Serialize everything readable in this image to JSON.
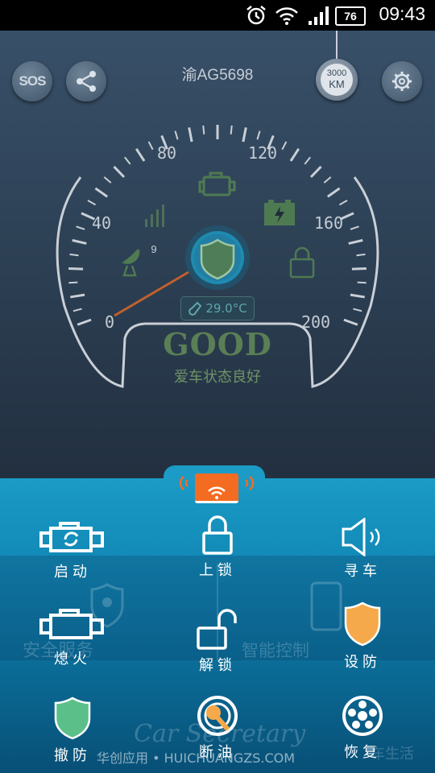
{
  "status_bar": {
    "time": "09:43",
    "battery": "76"
  },
  "header": {
    "plate": "渝AG5698",
    "sos_label": "SOS",
    "mileage_value": "3000",
    "mileage_unit": "KM"
  },
  "gauge": {
    "ticks": [
      "0",
      "40",
      "80",
      "120",
      "160",
      "200"
    ],
    "satellite_count": "9",
    "temperature": "29.0°C",
    "status_title": "GOOD",
    "status_subtitle": "爱车状态良好",
    "colors": {
      "good": "#5a7f55",
      "needle": "#c0602d",
      "shield": "#1e8bb0"
    }
  },
  "watermark": {
    "safety": "安全服务",
    "smart": "智能控制",
    "brand": "Car Secretary",
    "slogan": "车生活"
  },
  "controls": [
    {
      "label": "启动",
      "icon": "engine-start-icon"
    },
    {
      "label": "上锁",
      "icon": "lock-icon"
    },
    {
      "label": "寻车",
      "icon": "speaker-icon"
    },
    {
      "label": "熄火",
      "icon": "engine-stop-icon"
    },
    {
      "label": "解锁",
      "icon": "unlock-icon"
    },
    {
      "label": "设防",
      "icon": "shield-orange-icon"
    },
    {
      "label": "撤防",
      "icon": "shield-green-icon"
    },
    {
      "label": "断油",
      "icon": "oil-cut-icon"
    },
    {
      "label": "恢复",
      "icon": "wheel-icon"
    }
  ],
  "footer": {
    "text": "华创应用 • HUICHUANGZS.COM"
  },
  "accent_colors": {
    "panel": "#1b9bc6",
    "tab": "#f36c21",
    "arm_orange": "#f5a94a",
    "disarm_green": "#5bbf8a"
  }
}
